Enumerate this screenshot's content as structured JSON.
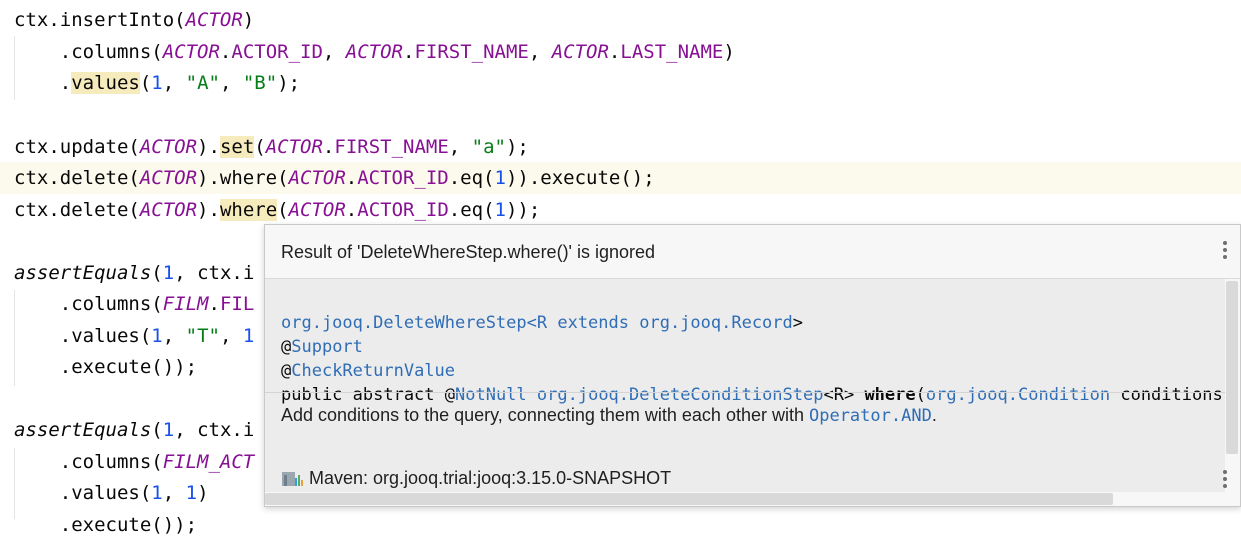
{
  "editor": {
    "lines": [
      {
        "segments": [
          [
            "ctx.insertInto(",
            ""
          ],
          [
            "ACTOR",
            "kw-c"
          ],
          [
            ")",
            ""
          ]
        ]
      },
      {
        "segments": [
          [
            "    .columns(",
            ""
          ],
          [
            "ACTOR",
            "kw-c"
          ],
          [
            ".",
            ""
          ],
          [
            "ACTOR_ID",
            "kw-f"
          ],
          [
            ", ",
            ""
          ],
          [
            "ACTOR",
            "kw-c"
          ],
          [
            ".",
            ""
          ],
          [
            "FIRST_NAME",
            "kw-f"
          ],
          [
            ", ",
            ""
          ],
          [
            "ACTOR",
            "kw-c"
          ],
          [
            ".",
            ""
          ],
          [
            "LAST_NAME",
            "kw-f"
          ],
          [
            ")",
            ""
          ]
        ]
      },
      {
        "segments": [
          [
            "    .",
            ""
          ],
          [
            "values",
            "warn"
          ],
          [
            "(",
            ""
          ],
          [
            "1",
            "num"
          ],
          [
            ", ",
            ""
          ],
          [
            "\"A\"",
            "str"
          ],
          [
            ", ",
            ""
          ],
          [
            "\"B\"",
            "str"
          ],
          [
            ");",
            ""
          ]
        ]
      },
      {
        "segments": []
      },
      {
        "segments": [
          [
            "ctx.update(",
            ""
          ],
          [
            "ACTOR",
            "kw-c"
          ],
          [
            ").",
            ""
          ],
          [
            "set",
            "warn"
          ],
          [
            "(",
            ""
          ],
          [
            "ACTOR",
            "kw-c"
          ],
          [
            ".",
            ""
          ],
          [
            "FIRST_NAME",
            "kw-f"
          ],
          [
            ", ",
            ""
          ],
          [
            "\"a\"",
            "str"
          ],
          [
            ");",
            ""
          ]
        ]
      },
      {
        "segments": [
          [
            "ctx.delete(",
            ""
          ],
          [
            "ACTOR",
            "kw-c"
          ],
          [
            ").where(",
            ""
          ],
          [
            "ACTOR",
            "kw-c"
          ],
          [
            ".",
            ""
          ],
          [
            "ACTOR_ID",
            "kw-f"
          ],
          [
            ".eq(",
            ""
          ],
          [
            "1",
            "num"
          ],
          [
            ")).execute();",
            ""
          ]
        ],
        "highlight": true
      },
      {
        "segments": [
          [
            "ctx.delete(",
            ""
          ],
          [
            "ACTOR",
            "kw-c"
          ],
          [
            ").",
            ""
          ],
          [
            "where",
            "warn"
          ],
          [
            "(",
            ""
          ],
          [
            "ACTOR",
            "kw-c"
          ],
          [
            ".",
            ""
          ],
          [
            "ACTOR_ID",
            "kw-f"
          ],
          [
            ".eq(",
            ""
          ],
          [
            "1",
            "num"
          ],
          [
            "));",
            ""
          ]
        ]
      },
      {
        "segments": []
      },
      {
        "segments": [
          [
            "assertEquals",
            "ital"
          ],
          [
            "(",
            ""
          ],
          [
            "1",
            "num"
          ],
          [
            ", ctx.i",
            ""
          ]
        ]
      },
      {
        "segments": [
          [
            "    .columns(",
            ""
          ],
          [
            "FILM",
            "kw-c"
          ],
          [
            ".",
            ""
          ],
          [
            "FIL",
            "kw-f"
          ]
        ]
      },
      {
        "segments": [
          [
            "    .values(",
            ""
          ],
          [
            "1",
            "num"
          ],
          [
            ", ",
            ""
          ],
          [
            "\"T\"",
            "str"
          ],
          [
            ", ",
            ""
          ],
          [
            "1",
            "num"
          ]
        ]
      },
      {
        "segments": [
          [
            "    .execute());",
            ""
          ]
        ]
      },
      {
        "segments": []
      },
      {
        "segments": [
          [
            "assertEquals",
            "ital"
          ],
          [
            "(",
            ""
          ],
          [
            "1",
            "num"
          ],
          [
            ", ctx.i",
            ""
          ]
        ]
      },
      {
        "segments": [
          [
            "    .columns(",
            ""
          ],
          [
            "FILM_ACT",
            "kw-c"
          ]
        ]
      },
      {
        "segments": [
          [
            "    .values(",
            ""
          ],
          [
            "1",
            "num"
          ],
          [
            ", ",
            ""
          ],
          [
            "1",
            "num"
          ],
          [
            ")",
            ""
          ]
        ]
      },
      {
        "segments": [
          [
            "    .execute());",
            ""
          ]
        ]
      }
    ]
  },
  "popup": {
    "title": "Result of 'DeleteWhereStep.where()' is ignored",
    "signature": {
      "line1_pkg": "org.jooq.DeleteWhereStep",
      "line1_mid": "<R extends ",
      "line1_rec": "org.jooq.Record",
      "line1_end": ">",
      "ann1_at": "@",
      "ann1": "Support",
      "ann2_at": "@",
      "ann2": "CheckReturnValue",
      "decl_start": "public abstract @",
      "notnull": "NotNull",
      "space1": " ",
      "ret_type": "org.jooq.DeleteConditionStep",
      "generic": "<R> ",
      "method": "where",
      "paren": "(",
      "param_type": "org.jooq.Condition",
      "param_rest": " conditions)"
    },
    "description_text": "Add conditions to the query, connecting them with each other with ",
    "description_link": "Operator.AND",
    "description_end": ".",
    "footer": "Maven: org.jooq.trial:jooq:3.15.0-SNAPSHOT"
  }
}
